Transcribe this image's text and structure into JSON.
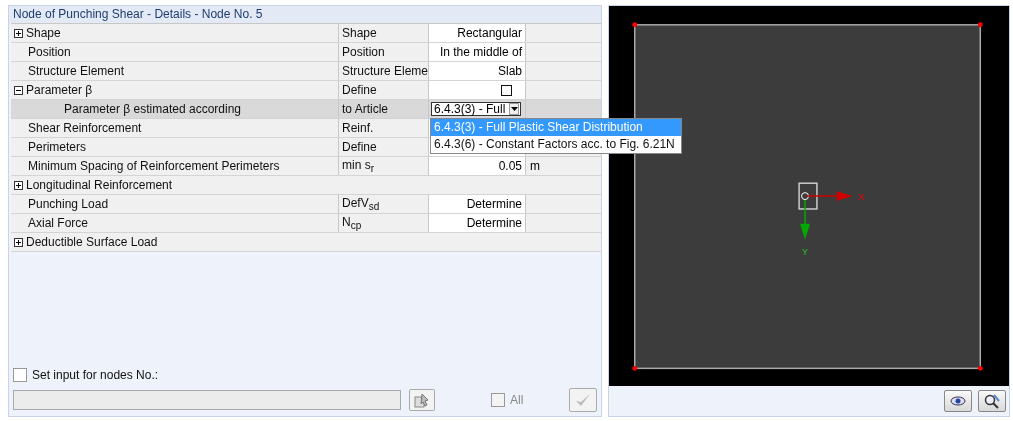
{
  "panel_title": "Node of Punching Shear - Details - Node No.  5",
  "rows": [
    {
      "kind": "item",
      "label": "Shape",
      "expandable": true,
      "expanded": false,
      "selected": false,
      "symbol": "Shape",
      "value": {
        "kind": "text",
        "text": "Rectangular"
      }
    },
    {
      "kind": "item",
      "label": "Position",
      "selected": false,
      "symbol": "Position",
      "value": {
        "kind": "text",
        "text": "In the middle of"
      }
    },
    {
      "kind": "item",
      "label": "Structure Element",
      "selected": false,
      "symbol": "Structure Eleme",
      "value": {
        "kind": "text",
        "text": "Slab"
      }
    },
    {
      "kind": "item",
      "label": "Parameter β",
      "expandable": true,
      "expanded": true,
      "selected": false,
      "symbol": "Define",
      "value": {
        "kind": "checkbox",
        "checked": false
      },
      "children": [
        {
          "kind": "item",
          "label": "Parameter β estimated according",
          "selected": true,
          "symbol": "to Article",
          "value": {
            "kind": "dropdown",
            "text": "6.4.3(3) - Full",
            "open": true,
            "options": [
              {
                "label": "6.4.3(3) - Full Plastic Shear Distribution",
                "selected": true
              },
              {
                "label": "6.4.3(6) - Constant Factors acc. to Fig. 6.21N",
                "selected": false
              }
            ]
          }
        }
      ]
    },
    {
      "kind": "item",
      "label": "Shear Reinforcement",
      "selected": false,
      "symbol": "Reinf."
    },
    {
      "kind": "item",
      "label": "Perimeters",
      "selected": false,
      "symbol": "Define"
    },
    {
      "kind": "item",
      "label": "Minimum Spacing of Reinforcement Perimeters",
      "selected": false,
      "symbol": "min s$_{r}$",
      "value": {
        "kind": "text",
        "text": "0.05"
      },
      "unit": "m"
    },
    {
      "kind": "group",
      "label": "Longitudinal Reinforcement",
      "expandable": true,
      "expanded": false,
      "selected": false
    },
    {
      "kind": "item",
      "label": "Punching Load",
      "selected": false,
      "symbol": "DefV$_{sd}$",
      "value": {
        "kind": "text",
        "text": "Determine"
      }
    },
    {
      "kind": "item",
      "label": "Axial Force",
      "selected": false,
      "symbol": "N$_{cp}$",
      "value": {
        "kind": "text",
        "text": "Determine"
      }
    },
    {
      "kind": "group",
      "label": "Deductible Surface Load",
      "expandable": true,
      "expanded": false,
      "selected": false
    }
  ],
  "set_input": {
    "label": "Set input for nodes No.:",
    "checked": false,
    "field_disabled": true,
    "all_label": "All",
    "all_checked": false,
    "all_disabled": true,
    "apply_disabled": true
  },
  "viewport": {
    "x_axis": "X",
    "y_axis": "Y"
  }
}
